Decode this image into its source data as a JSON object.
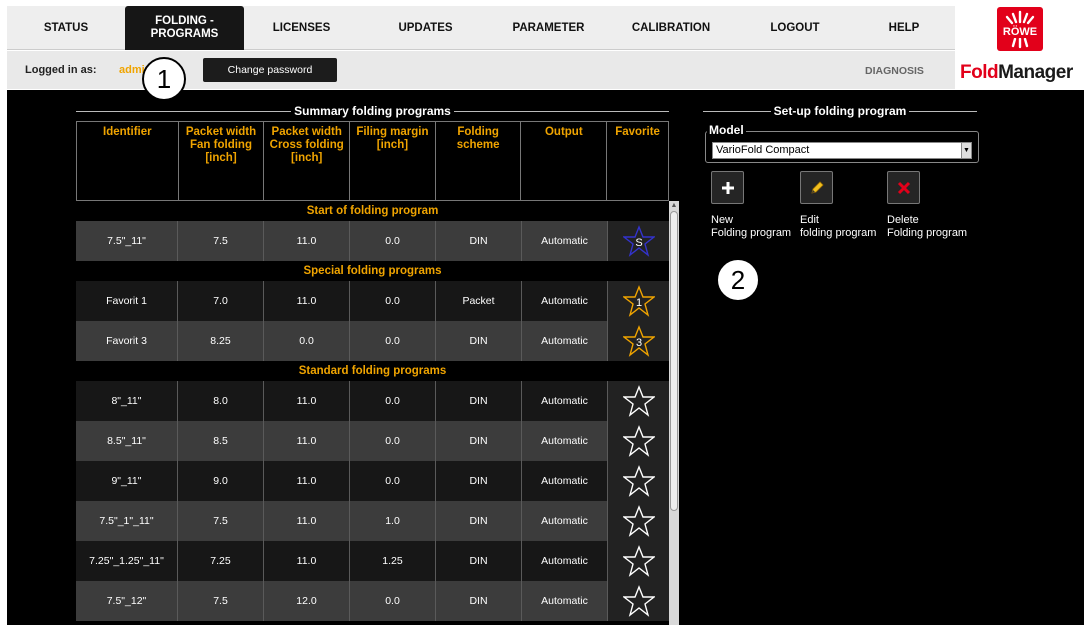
{
  "nav": {
    "items": [
      {
        "label": "STATUS"
      },
      {
        "label": "FOLDING -\nPROGRAMS"
      },
      {
        "label": "LICENSES"
      },
      {
        "label": "UPDATES"
      },
      {
        "label": "PARAMETER"
      },
      {
        "label": "CALIBRATION"
      },
      {
        "label": "LOGOUT"
      },
      {
        "label": "HELP"
      }
    ],
    "active": "FOLDING -\nPROGRAMS"
  },
  "brand": {
    "logo_text": "RÖWE",
    "app_name_part1": "Fold",
    "app_name_part2": "Manager",
    "brand_color": "#e2001a"
  },
  "subbar": {
    "logged_in_label": "Logged in as:",
    "user": "admin",
    "change_password": "Change password",
    "diagnosis": "DIAGNOSIS"
  },
  "callouts": [
    "1",
    "2"
  ],
  "summary": {
    "title": "Summary folding programs",
    "columns": [
      "Identifier",
      "Packet width\nFan folding\n[inch]",
      "Packet width\nCross folding\n[inch]",
      "Filing margin\n[inch]",
      "Folding\nscheme",
      "Output",
      "Favorite"
    ],
    "groups": [
      {
        "title": "Start of folding program",
        "rows": [
          {
            "id": "7.5\"_11\"",
            "fan": "7.5",
            "cross": "11.0",
            "margin": "0.0",
            "scheme": "DIN",
            "output": "Automatic",
            "fav": "S",
            "fav_color": "#3333cc"
          }
        ]
      },
      {
        "title": "Special folding programs",
        "rows": [
          {
            "id": "Favorit 1",
            "fan": "7.0",
            "cross": "11.0",
            "margin": "0.0",
            "scheme": "Packet",
            "output": "Automatic",
            "fav": "1",
            "fav_color": "#f0a400"
          },
          {
            "id": "Favorit 3",
            "fan": "8.25",
            "cross": "0.0",
            "margin": "0.0",
            "scheme": "DIN",
            "output": "Automatic",
            "fav": "3",
            "fav_color": "#f0a400"
          }
        ]
      },
      {
        "title": "Standard folding programs",
        "rows": [
          {
            "id": "8\"_11\"",
            "fan": "8.0",
            "cross": "11.0",
            "margin": "0.0",
            "scheme": "DIN",
            "output": "Automatic",
            "fav": "",
            "fav_color": "#ffffff"
          },
          {
            "id": "8.5\"_11\"",
            "fan": "8.5",
            "cross": "11.0",
            "margin": "0.0",
            "scheme": "DIN",
            "output": "Automatic",
            "fav": "",
            "fav_color": "#ffffff"
          },
          {
            "id": "9\"_11\"",
            "fan": "9.0",
            "cross": "11.0",
            "margin": "0.0",
            "scheme": "DIN",
            "output": "Automatic",
            "fav": "",
            "fav_color": "#ffffff"
          },
          {
            "id": "7.5\"_1\"_11\"",
            "fan": "7.5",
            "cross": "11.0",
            "margin": "1.0",
            "scheme": "DIN",
            "output": "Automatic",
            "fav": "",
            "fav_color": "#ffffff"
          },
          {
            "id": "7.25\"_1.25\"_11\"",
            "fan": "7.25",
            "cross": "11.0",
            "margin": "1.25",
            "scheme": "DIN",
            "output": "Automatic",
            "fav": "",
            "fav_color": "#ffffff"
          },
          {
            "id": "7.5\"_12\"",
            "fan": "7.5",
            "cross": "12.0",
            "margin": "0.0",
            "scheme": "DIN",
            "output": "Automatic",
            "fav": "",
            "fav_color": "#ffffff"
          }
        ]
      }
    ]
  },
  "setup": {
    "title": "Set-up folding program",
    "model_label": "Model",
    "model_value": "VarioFold Compact",
    "buttons": [
      {
        "icon": "plus-icon",
        "label": "New\nFolding program"
      },
      {
        "icon": "pencil-icon",
        "label": "Edit\nfolding program"
      },
      {
        "icon": "delete-x-icon",
        "label": "Delete\nFolding program"
      }
    ]
  }
}
